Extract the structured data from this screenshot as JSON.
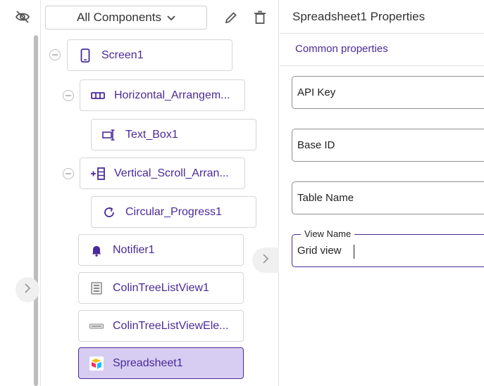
{
  "rail": {
    "hide_icon": "eye-off-icon",
    "expand_icon": "chevron-right-icon"
  },
  "tree": {
    "selector_label": "All Components",
    "edit_icon": "pencil-icon",
    "delete_icon": "trash-icon",
    "nodes": [
      {
        "label": "Screen1",
        "icon": "phone-icon"
      },
      {
        "label": "Horizontal_Arrangem...",
        "icon": "horizontal-arrangement-icon"
      },
      {
        "label": "Text_Box1",
        "icon": "textbox-icon"
      },
      {
        "label": "Vertical_Scroll_Arran...",
        "icon": "vertical-scroll-icon"
      },
      {
        "label": "Circular_Progress1",
        "icon": "circular-progress-icon"
      },
      {
        "label": "Notifier1",
        "icon": "bell-icon"
      },
      {
        "label": "ColinTreeListView1",
        "icon": "listview-icon"
      },
      {
        "label": "ColinTreeListViewEle...",
        "icon": "list-element-icon"
      },
      {
        "label": "Spreadsheet1",
        "icon": "spreadsheet-icon"
      }
    ],
    "selected_node": "Spreadsheet1"
  },
  "properties": {
    "title": "Spreadsheet1 Properties",
    "section_link": "Common properties",
    "fields": [
      {
        "label": "API Key",
        "value": ""
      },
      {
        "label": "Base ID",
        "value": ""
      },
      {
        "label": "Table Name",
        "value": ""
      },
      {
        "label": "View Name",
        "value": "Grid view"
      }
    ]
  },
  "colors": {
    "accent": "#4a2a9a",
    "selected_bg": "#d7cdf3",
    "border": "#d6d6d6"
  }
}
